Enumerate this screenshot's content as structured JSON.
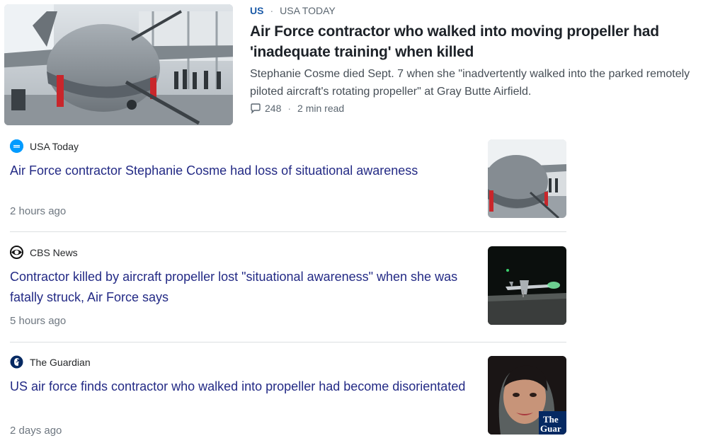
{
  "top_story": {
    "category": "US",
    "separator": "·",
    "publisher": "USA TODAY",
    "title": "Air Force contractor who walked into moving propeller had 'inadequate training' when killed",
    "summary": "Stephanie Cosme died Sept. 7 when she \"inadvertently walked into the parked remotely piloted aircraft's rotating propeller\" at Gray Butte Airfield.",
    "comment_count": "248",
    "read_time": "2 min read",
    "image_icon": "drone-hangar-photo"
  },
  "related": [
    {
      "source": "USA Today",
      "source_icon": "usa-today-logo-icon",
      "title": "Air Force contractor Stephanie Cosme had loss of situational awareness",
      "time": "2 hours ago",
      "image_icon": "drone-photo"
    },
    {
      "source": "CBS News",
      "source_icon": "cbs-eye-logo-icon",
      "title": "Contractor killed by aircraft propeller lost \"situational awareness\" when she was fatally struck, Air Force says",
      "time": "5 hours ago",
      "image_icon": "night-aircraft-photo"
    },
    {
      "source": "The Guardian",
      "source_icon": "guardian-logo-icon",
      "title": "US air force finds contractor who walked into propeller had become disorientated",
      "time": "2 days ago",
      "image_icon": "portrait-photo",
      "image_watermark": "The Guardian"
    }
  ],
  "colors": {
    "category": "#1d5ca8",
    "link_title": "#232a85",
    "usa_today_blue": "#009bff"
  }
}
